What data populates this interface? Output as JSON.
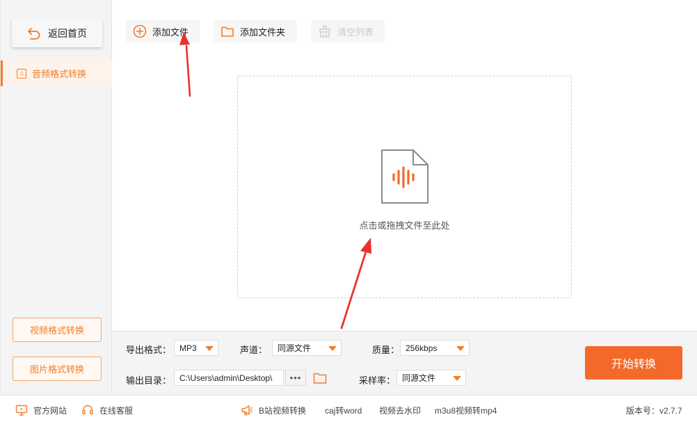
{
  "sidebar": {
    "back_label": "返回首页",
    "active_item": "音频格式转换",
    "video_btn": "视频格式转换",
    "image_btn": "图片格式转换"
  },
  "toolbar": {
    "add_file": "添加文件",
    "add_folder": "添加文件夹",
    "clear_list": "清空列表"
  },
  "dropzone": {
    "hint": "点击或拖拽文件至此处"
  },
  "settings": {
    "format_label": "导出格式：",
    "format_value": "MP3",
    "channel_label": "声道：",
    "channel_value": "同源文件",
    "quality_label": "质量：",
    "quality_value": "256kbps",
    "output_label": "输出目录：",
    "output_path": "C:\\Users\\admin\\Desktop\\",
    "dots": "•••",
    "samplerate_label": "采样率：",
    "samplerate_value": "同源文件",
    "start_label": "开始转换"
  },
  "footer": {
    "website": "官方网站",
    "support": "在线客服",
    "link1": "B站视频转换",
    "link2": "caj转word",
    "link3": "视频去水印",
    "link4": "m3u8视频转mp4",
    "version": "版本号：v2.7.7"
  },
  "colors": {
    "accent": "#f07d2a",
    "start_button": "#f4692a",
    "annotation_arrow": "#e8322e"
  },
  "icons": [
    "back-arrow-icon",
    "music-note-icon",
    "plus-circle-icon",
    "folder-icon",
    "broom-icon",
    "audio-file-icon",
    "monitor-icon",
    "headset-icon",
    "megaphone-icon"
  ]
}
